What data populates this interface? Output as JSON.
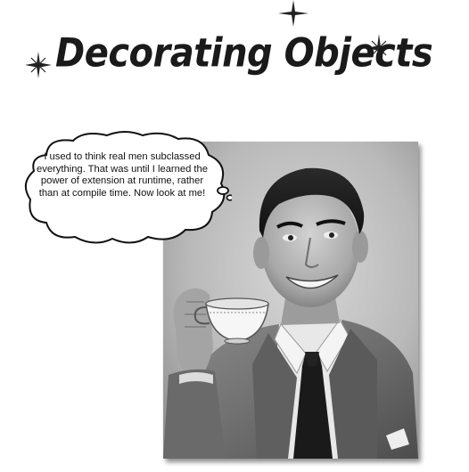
{
  "title": "Decorating Objects",
  "speech_bubble": {
    "text": "I used to think real men subclassed everything.  That was until I learned the power of extension at runtime, rather than at compile time.  Now look at me!"
  },
  "icons": [
    "sparkle-icon"
  ]
}
